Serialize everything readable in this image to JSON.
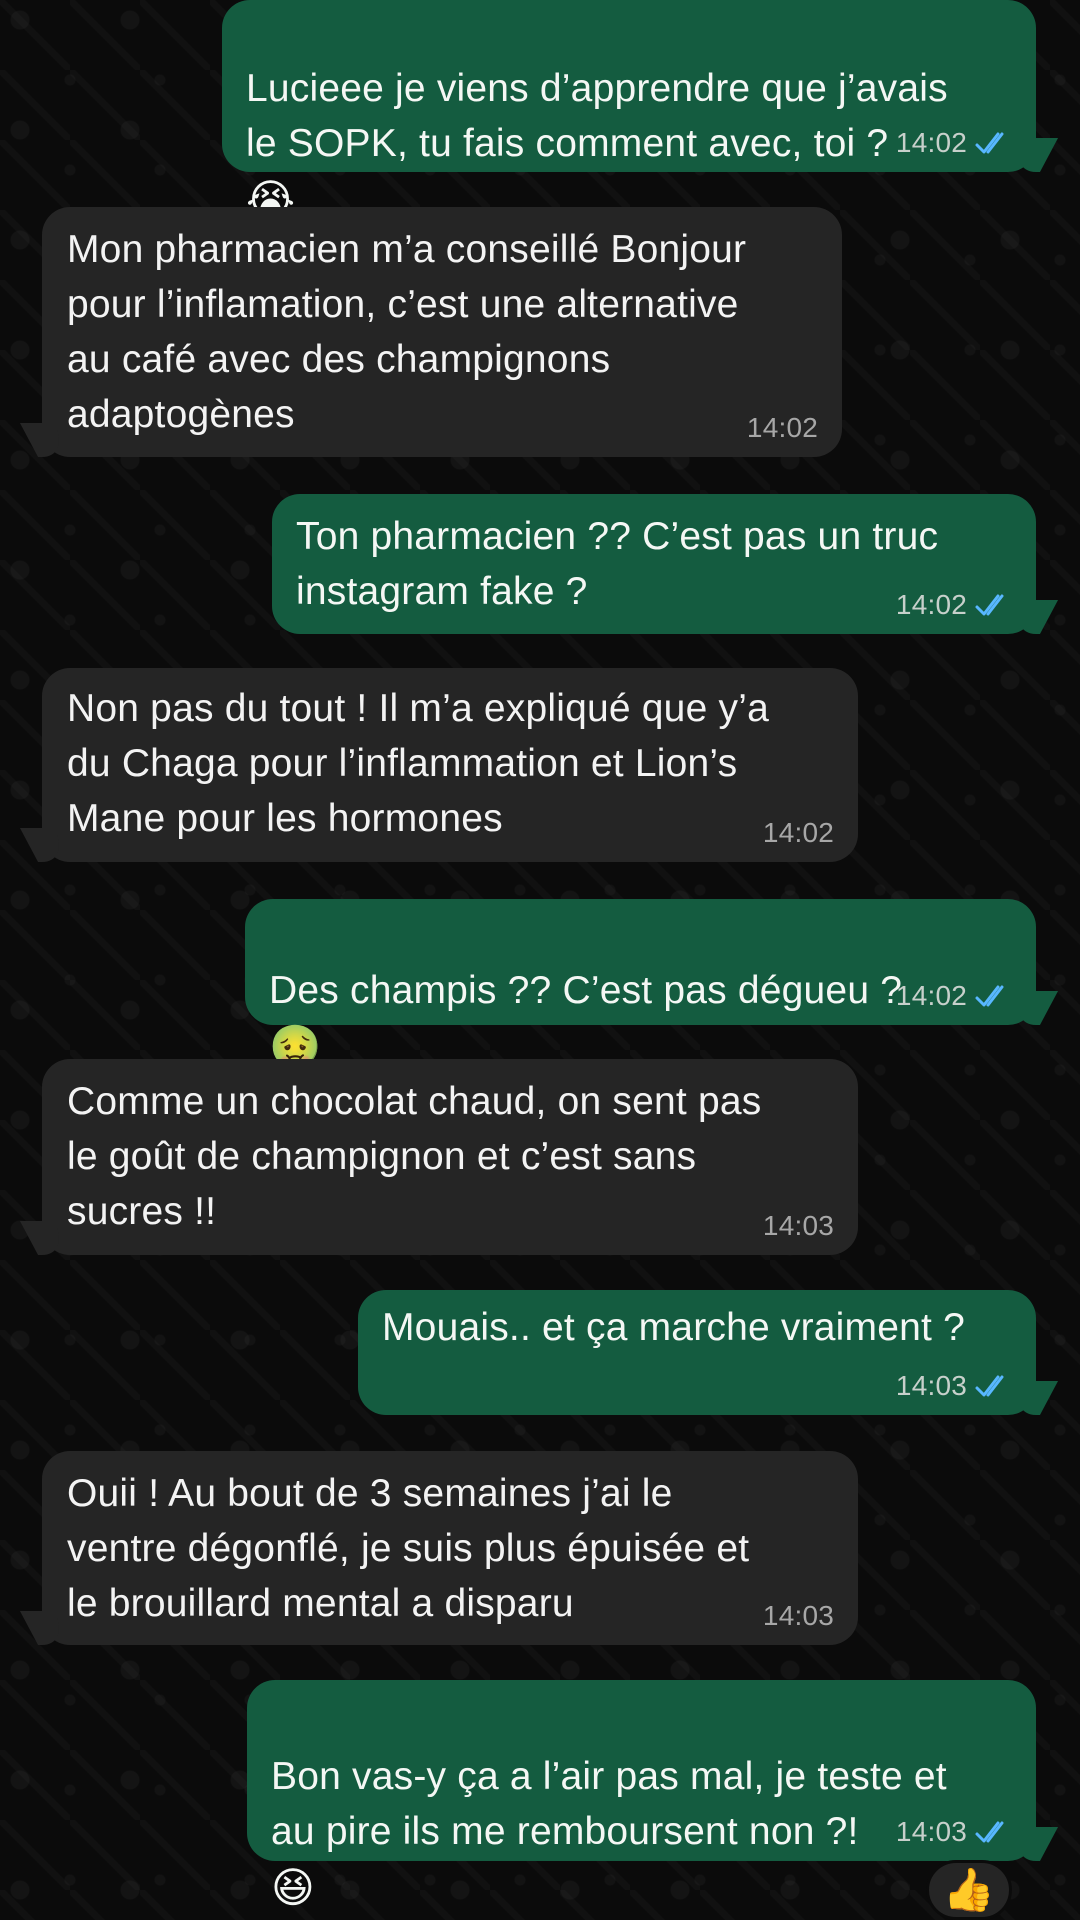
{
  "messages": [
    {
      "text": "Lucieee je viens d’apprendre que j’avais\nle SOPK, tu fais comment avec, toi ?",
      "emoji": "😭",
      "time": "14:02",
      "status": "read"
    },
    {
      "text": "Mon pharmacien m’a conseillé Bonjour\npour l’inflamation, c’est une alternative\nau café avec des champignons\nadaptogènes",
      "time": "14:02"
    },
    {
      "text": "Ton pharmacien ??  C’est pas un truc\ninstagram fake ?",
      "time": "14:02",
      "status": "read"
    },
    {
      "text": "Non pas du tout ! Il m’a expliqué que y’a\ndu Chaga pour l’inflammation et Lion’s\nMane pour les hormones",
      "time": "14:02"
    },
    {
      "text": "Des champis ?? C’est pas dégueu ?",
      "emoji": "🤢",
      "time": "14:02",
      "status": "read"
    },
    {
      "text": "Comme un chocolat chaud, on sent pas\nle goût de champignon et c’est sans\nsucres !!",
      "time": "14:03"
    },
    {
      "text": "Mouais.. et ça marche vraiment ?",
      "time": "14:03",
      "status": "read"
    },
    {
      "text": "Ouii ! Au bout de 3 semaines j’ai le\nventre dégonflé, je suis plus épuisée  et\nle brouillard mental a disparu",
      "time": "14:03"
    },
    {
      "text": "Bon vas-y ça a l’air pas mal, je teste et\nau pire ils me remboursent non ?!",
      "emoji": "😆",
      "time": "14:03",
      "status": "read"
    }
  ],
  "reaction": {
    "emoji": "👍"
  },
  "colors": {
    "background": "#0b0b0b",
    "outgoing_bubble": "#145c40",
    "incoming_bubble": "#252525",
    "read_ticks": "#58b7ff"
  }
}
